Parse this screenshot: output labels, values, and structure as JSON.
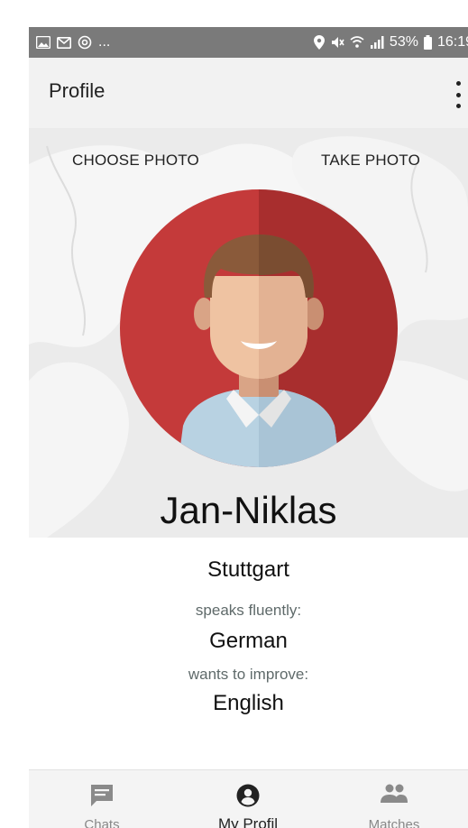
{
  "status_bar": {
    "left_icons": [
      "image-icon",
      "gmail-icon",
      "sync-icon"
    ],
    "more": "...",
    "battery": "53%",
    "time": "16:19"
  },
  "app_bar": {
    "title": "Profile",
    "menu_icon": "more-vert-icon"
  },
  "photo_actions": {
    "choose": "CHOOSE PHOTO",
    "take": "TAKE PHOTO"
  },
  "profile": {
    "name": "Jan-Niklas",
    "city": "Stuttgart",
    "speaks_label": "speaks fluently:",
    "speaks_value": "German",
    "improve_label": "wants to improve:",
    "improve_value": "English"
  },
  "bottom_nav": {
    "items": [
      {
        "label": "Chats",
        "icon": "chat-icon",
        "active": false
      },
      {
        "label": "My Profil",
        "icon": "account-circle-icon",
        "active": true
      },
      {
        "label": "Matches",
        "icon": "people-icon",
        "active": false
      }
    ]
  },
  "colors": {
    "avatar_bg_left": "#c43a3a",
    "avatar_bg_right": "#a82e2e",
    "status_bar": "#7a7a7a",
    "app_bar": "#f2f2f2"
  }
}
